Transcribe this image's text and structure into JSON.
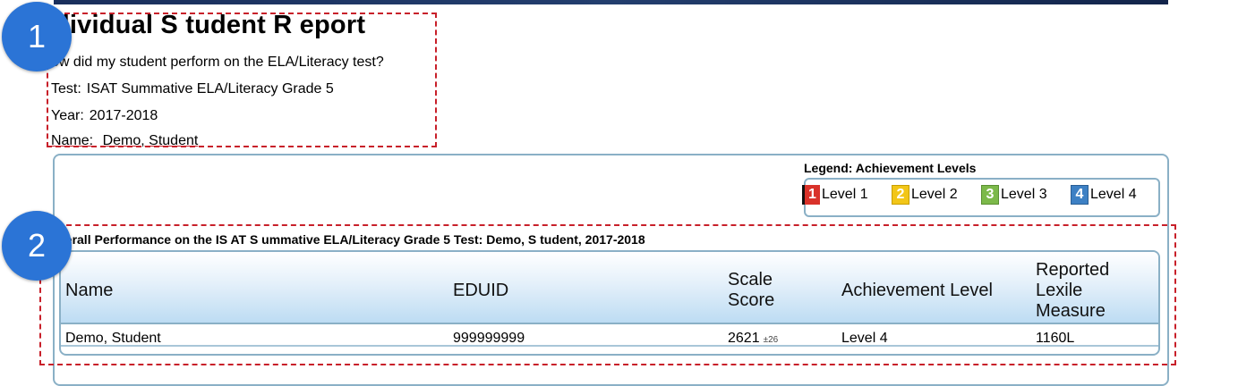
{
  "report": {
    "title": "dividual S tudent R eport",
    "question": "ow did my student perform on the ELA/Literacy test?",
    "test_label": "Test:",
    "test_value": "ISAT Summative ELA/Literacy Grade 5",
    "year_label": "Year:",
    "year_value": "2017-2018",
    "name_label": "Name:",
    "name_value": "Demo, Student"
  },
  "callouts": [
    "1",
    "2"
  ],
  "legend": {
    "title": "Legend: Achievement Levels",
    "items": [
      {
        "num": "1",
        "label": "Level 1",
        "color": "#d9322a"
      },
      {
        "num": "2",
        "label": "Level 2",
        "color": "#f2c618"
      },
      {
        "num": "3",
        "label": "Level 3",
        "color": "#7cb94a"
      },
      {
        "num": "4",
        "label": "Level 4",
        "color": "#3d80c4"
      }
    ]
  },
  "performance": {
    "title": "verall Performance on the IS AT S ummative ELA/Literacy Grade 5 Test: Demo, S tudent, 2017-2018",
    "columns": [
      {
        "line1": "Name",
        "line2": "",
        "line3": ""
      },
      {
        "line1": "EDUID",
        "line2": "",
        "line3": ""
      },
      {
        "line1": "Scale",
        "line2": "Score",
        "line3": ""
      },
      {
        "line1": "Achievement Level",
        "line2": "",
        "line3": ""
      },
      {
        "line1": "Reported",
        "line2": "Lexile",
        "line3": "Measure"
      }
    ],
    "row": {
      "name": "Demo, Student",
      "eduid": "999999999",
      "scale_score": "2621",
      "scale_error": "±26",
      "achievement_level": "Level 4",
      "lexile": "1160L"
    }
  },
  "accent": {
    "callout": "#2b74d6",
    "dash": "#c8202a",
    "panel_border": "#8ab0c6"
  }
}
